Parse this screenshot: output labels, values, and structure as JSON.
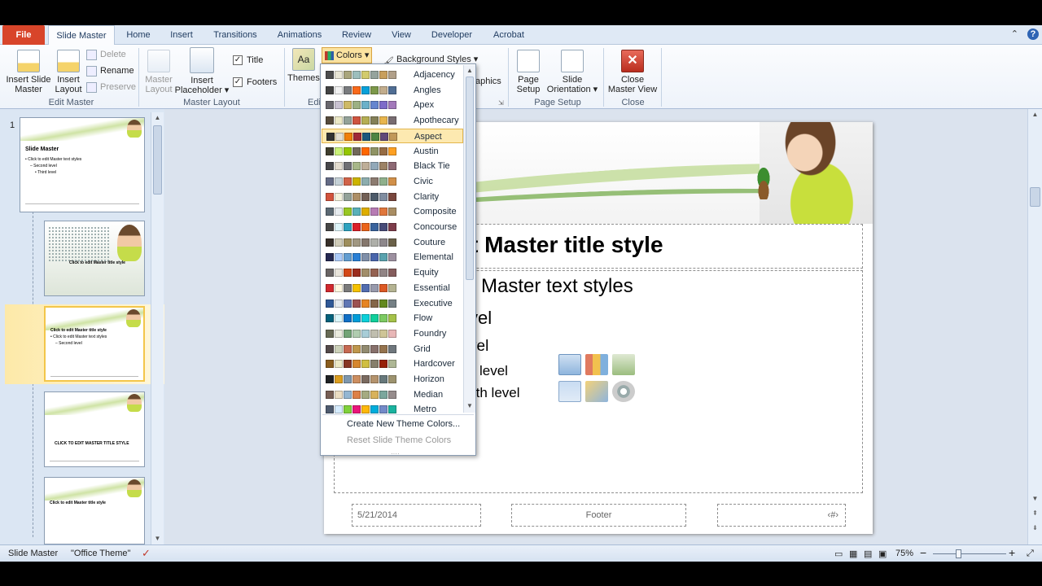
{
  "tabs": {
    "file": "File",
    "items": [
      "Slide Master",
      "Home",
      "Insert",
      "Transitions",
      "Animations",
      "Review",
      "View",
      "Developer",
      "Acrobat"
    ],
    "controls": [
      "⌃",
      "?"
    ]
  },
  "ribbon": {
    "edit_master": {
      "insert_slide_master": "Insert Slide\nMaster",
      "insert_slide_master_l1": "Insert Slide",
      "insert_slide_master_l2": "Master",
      "insert_layout_l1": "Insert",
      "insert_layout_l2": "Layout",
      "delete": "Delete",
      "rename": "Rename",
      "preserve": "Preserve",
      "group_name": "Edit Master"
    },
    "master_layout": {
      "master_layout_l1": "Master",
      "master_layout_l2": "Layout",
      "insert_placeholder_l1": "Insert",
      "insert_placeholder_l2": "Placeholder ▾",
      "title": "Title",
      "footers": "Footers",
      "group_name": "Master Layout"
    },
    "edit_theme": {
      "themes": "Themes",
      "colors": "Colors",
      "background_styles": "Background Styles ▾",
      "graphics": "aphics",
      "group_name": "Edi"
    },
    "page_setup": {
      "page_setup_l1": "Page",
      "page_setup_l2": "Setup",
      "slide_orientation_l1": "Slide",
      "slide_orientation_l2": "Orientation ▾",
      "group_name": "Page Setup"
    },
    "close": {
      "close_l1": "Close",
      "close_l2": "Master View",
      "group_name": "Close"
    }
  },
  "thumbs": {
    "slide_number": "1",
    "t1_title": "Slide Master",
    "t1_l1": "• Click to edit Master text styles",
    "t1_l2": "– Second level",
    "t1_l3": "• Third level",
    "t2_title": "Click to edit Master title style",
    "t3_title": "Click to edit Master title style",
    "t3_l1": "• Click to edit Master text styles",
    "t3_l2": "– Second level",
    "t4_title": "CLICK TO EDIT MASTER TITLE STYLE",
    "t5_title": "Click to edit Master title style"
  },
  "slide": {
    "title": "t Master title style",
    "text_l1": "Master text styles",
    "text_l2": "vel",
    "text_l3": "vel",
    "text_l4": "level",
    "text_l5": "rth level",
    "date": "5/21/2014",
    "footer": "Footer",
    "pagenum": "‹#›"
  },
  "dropdown": {
    "themes": [
      {
        "name": "Adjacency",
        "colors": [
          "#4d4d4d",
          "#e8e5d5",
          "#a9a57c",
          "#9cbebd",
          "#d2cb6c",
          "#95a39d",
          "#c89f5d",
          "#b1a089"
        ]
      },
      {
        "name": "Angles",
        "colors": [
          "#434343",
          "#f2f2f2",
          "#797b7e",
          "#f96a1b",
          "#08a1d9",
          "#7c984a",
          "#c2ad8d",
          "#506e94"
        ]
      },
      {
        "name": "Apex",
        "colors": [
          "#69676d",
          "#c9c2d1",
          "#ceb966",
          "#9cb084",
          "#6bb1c9",
          "#6585cf",
          "#7e6bc9",
          "#a379bb"
        ]
      },
      {
        "name": "Apothecary",
        "colors": [
          "#564b3c",
          "#ece9c6",
          "#93a299",
          "#cf543f",
          "#b5ae53",
          "#848058",
          "#e8b54d",
          "#786c71"
        ]
      },
      {
        "name": "Aspect",
        "colors": [
          "#323232",
          "#e3ded1",
          "#f07f09",
          "#9f2936",
          "#1b587c",
          "#4e8542",
          "#604878",
          "#c19859"
        ]
      },
      {
        "name": "Austin",
        "colors": [
          "#3e3d2d",
          "#caf278",
          "#94c600",
          "#71685a",
          "#ff6700",
          "#909465",
          "#956b43",
          "#fea022"
        ]
      },
      {
        "name": "Black Tie",
        "colors": [
          "#46464a",
          "#e3dcCF",
          "#6f6f74",
          "#a7b789",
          "#beae98",
          "#92a9b9",
          "#9c8265",
          "#8d6974"
        ]
      },
      {
        "name": "Civic",
        "colors": [
          "#646b86",
          "#c5d1d7",
          "#d16349",
          "#ccb400",
          "#8cadae",
          "#8c7b70",
          "#8fb08c",
          "#d19049"
        ]
      },
      {
        "name": "Clarity",
        "colors": [
          "#d2533c",
          "#f3f2dc",
          "#93a299",
          "#ad8f67",
          "#726056",
          "#4c5a6a",
          "#808da0",
          "#79463d"
        ]
      },
      {
        "name": "Composite",
        "colors": [
          "#5b6973",
          "#e7ecf0",
          "#98c723",
          "#59b0b9",
          "#deae00",
          "#b77bb4",
          "#e0773c",
          "#a98d63"
        ]
      },
      {
        "name": "Concourse",
        "colors": [
          "#464646",
          "#def5fa",
          "#2da2bf",
          "#da1f28",
          "#eb641b",
          "#39639d",
          "#474b78",
          "#7d3c4a"
        ]
      },
      {
        "name": "Couture",
        "colors": [
          "#37302a",
          "#d0ccb9",
          "#9e8e5c",
          "#a09781",
          "#85776d",
          "#aeafa9",
          "#8d878b",
          "#6b6149"
        ]
      },
      {
        "name": "Elemental",
        "colors": [
          "#242852",
          "#accbf9",
          "#629dd1",
          "#297fd5",
          "#7f8fa9",
          "#4a66ac",
          "#5aa2ae",
          "#9d90a0"
        ]
      },
      {
        "name": "Equity",
        "colors": [
          "#696464",
          "#e9e5dc",
          "#d34817",
          "#9b2d1f",
          "#a28e6a",
          "#956251",
          "#918485",
          "#855d5d"
        ]
      },
      {
        "name": "Essential",
        "colors": [
          "#d1282e",
          "#fff8e1",
          "#7a7a7a",
          "#f5c201",
          "#526db0",
          "#989aac",
          "#dc5924",
          "#b4b392"
        ]
      },
      {
        "name": "Executive",
        "colors": [
          "#2f5897",
          "#e4e9ef",
          "#6076b4",
          "#9c5252",
          "#e68422",
          "#846648",
          "#63891f",
          "#758085"
        ]
      },
      {
        "name": "Flow",
        "colors": [
          "#04617b",
          "#dbf5f9",
          "#0f6fc6",
          "#009dd9",
          "#0bd0d9",
          "#10cf9b",
          "#7cca62",
          "#a5c249"
        ]
      },
      {
        "name": "Foundry",
        "colors": [
          "#676a55",
          "#eaebde",
          "#72a376",
          "#b0ccb0",
          "#a8cdd7",
          "#c0beaf",
          "#cec597",
          "#e8b7b7"
        ]
      },
      {
        "name": "Grid",
        "colors": [
          "#534949",
          "#ccd1b9",
          "#c66951",
          "#bf974d",
          "#928b70",
          "#87706b",
          "#94734e",
          "#6f777d"
        ]
      },
      {
        "name": "Hardcover",
        "colors": [
          "#895d1d",
          "#ece9c6",
          "#873624",
          "#d6862d",
          "#d0be40",
          "#877f6c",
          "#972109",
          "#aeb795"
        ]
      },
      {
        "name": "Horizon",
        "colors": [
          "#1f2123",
          "#dc9e1f",
          "#7e97ad",
          "#cc8e60",
          "#7a6a60",
          "#b4936d",
          "#67787b",
          "#9d936f"
        ]
      },
      {
        "name": "Median",
        "colors": [
          "#775f55",
          "#ebddc3",
          "#94b6d2",
          "#dd8047",
          "#a5ab81",
          "#d8b25c",
          "#7ba79d",
          "#968c8c"
        ]
      },
      {
        "name": "Metro",
        "colors": [
          "#4e5b6f",
          "#d6ecff",
          "#7fd13b",
          "#ea157a",
          "#feb80a",
          "#00addc",
          "#738ac8",
          "#1ab39f"
        ]
      }
    ],
    "create_new": "Create New Theme Colors...",
    "reset": "Reset Slide Theme Colors",
    "grip": "····"
  },
  "status": {
    "view": "Slide Master",
    "theme": "\"Office Theme\"",
    "zoom": "75%",
    "zoom_out": "−",
    "zoom_in": "+"
  }
}
